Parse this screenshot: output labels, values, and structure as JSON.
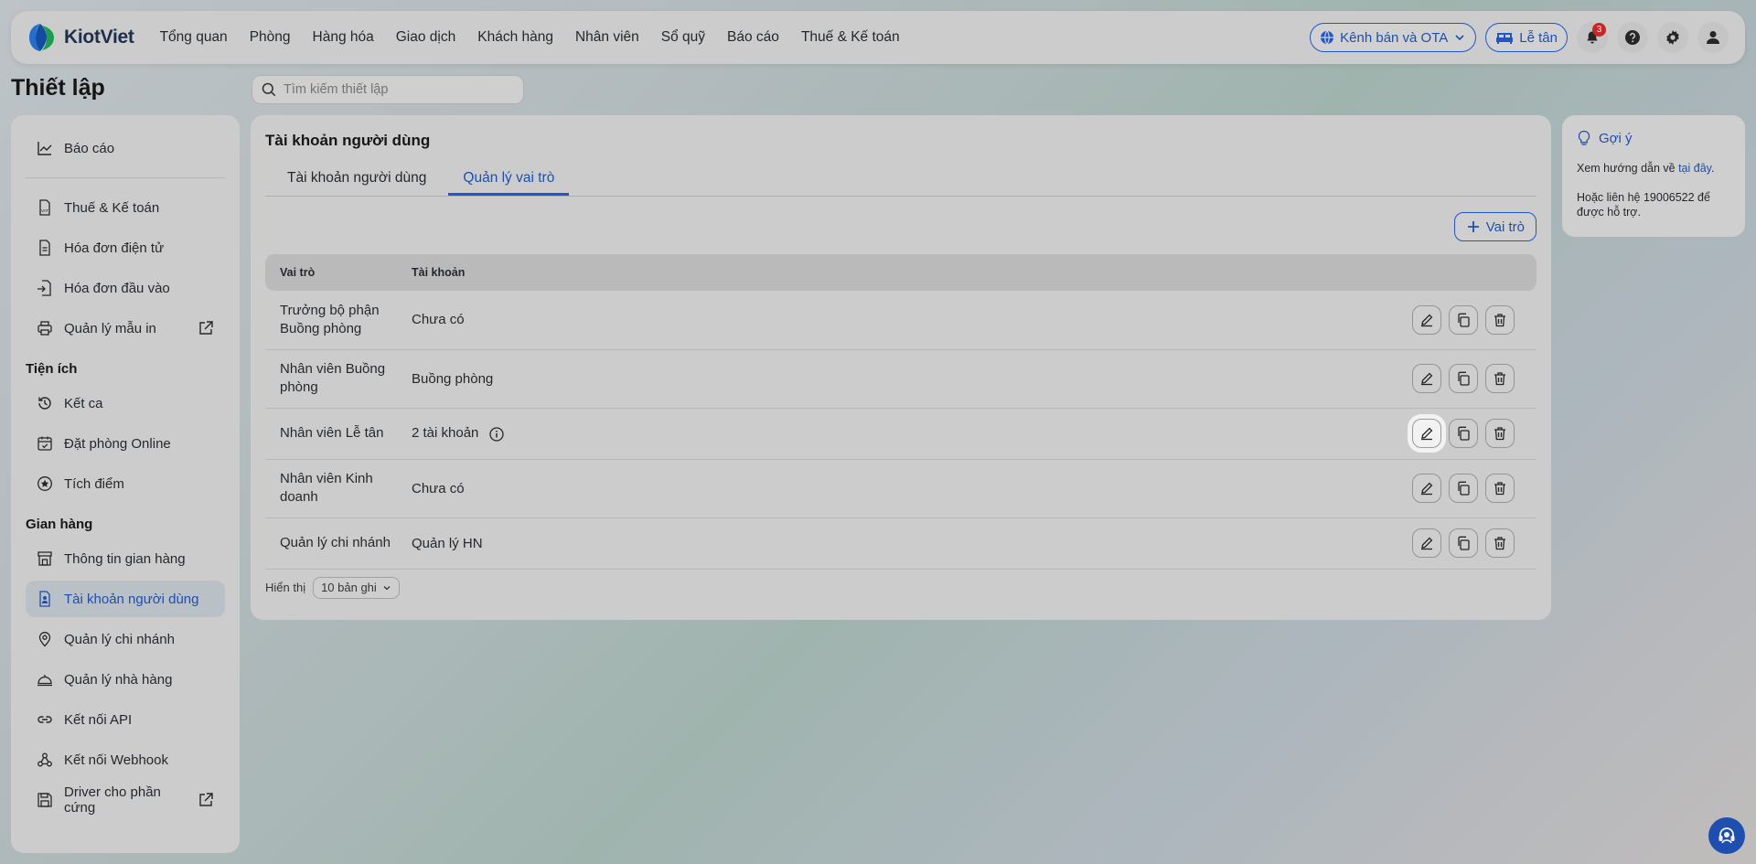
{
  "brand": {
    "name": "KiotViet"
  },
  "nav": {
    "menu": [
      "Tổng quan",
      "Phòng",
      "Hàng hóa",
      "Giao dịch",
      "Khách hàng",
      "Nhân viên",
      "Sổ quỹ",
      "Báo cáo",
      "Thuế & Kế toán"
    ],
    "channel_btn": "Kênh bán và OTA",
    "reception_btn": "Lễ tân",
    "notification_count": "3"
  },
  "page": {
    "title": "Thiết lập",
    "search_placeholder": "Tìm kiếm thiết lập"
  },
  "sidebar": {
    "top": [
      {
        "label": "Báo cáo",
        "icon": "chart-line-icon"
      }
    ],
    "group1": [
      {
        "label": "Thuế & Kế toán",
        "icon": "vat-doc-icon"
      },
      {
        "label": "Hóa đơn điện tử",
        "icon": "invoice-icon"
      },
      {
        "label": "Hóa đơn đầu vào",
        "icon": "import-invoice-icon"
      },
      {
        "label": "Quản lý mẫu in",
        "icon": "printer-icon"
      }
    ],
    "section_utils": "Tiện ích",
    "utils": [
      {
        "label": "Kết ca",
        "icon": "history-icon"
      },
      {
        "label": "Đặt phòng Online",
        "icon": "calendar-icon"
      },
      {
        "label": "Tích điểm",
        "icon": "star-circle-icon"
      }
    ],
    "section_store": "Gian hàng",
    "store": [
      {
        "label": "Thông tin gian hàng",
        "icon": "store-icon"
      },
      {
        "label": "Tài khoản người dùng",
        "icon": "user-doc-icon"
      },
      {
        "label": "Quản lý chi nhánh",
        "icon": "location-icon"
      },
      {
        "label": "Quản lý nhà hàng",
        "icon": "cloche-icon"
      },
      {
        "label": "Kết nối API",
        "icon": "link-icon"
      },
      {
        "label": "Kết nối Webhook",
        "icon": "webhook-icon"
      },
      {
        "label": "Driver cho phần cứng",
        "icon": "save-icon"
      }
    ]
  },
  "main": {
    "title": "Tài khoản người dùng",
    "tabs": [
      "Tài khoản người dùng",
      "Quản lý vai trò"
    ],
    "add_role_btn": "Vai trò",
    "columns": [
      "Vai trò",
      "Tài khoản"
    ],
    "rows": [
      {
        "role": "Trưởng bộ phận Buồng phòng",
        "account": "Chưa có"
      },
      {
        "role": "Nhân viên Buồng phòng",
        "account": "Buồng phòng"
      },
      {
        "role": "Nhân viên Lễ tân",
        "account": "2 tài khoản"
      },
      {
        "role": "Nhân viên Kinh doanh",
        "account": "Chưa có"
      },
      {
        "role": "Quản lý chi nhánh",
        "account": "Quản lý HN"
      }
    ],
    "footer_label": "Hiển thị",
    "page_size": "10 bản ghi"
  },
  "hint": {
    "title": "Gợi ý",
    "line1_prefix": "Xem hướng dẫn về ",
    "line1_link": "tại đây",
    "line1_suffix": ".",
    "line2": "Hoặc liên hệ 19006522 để được hỗ trợ."
  },
  "colors": {
    "accent": "#1a56db",
    "badge": "#d61f1f"
  }
}
